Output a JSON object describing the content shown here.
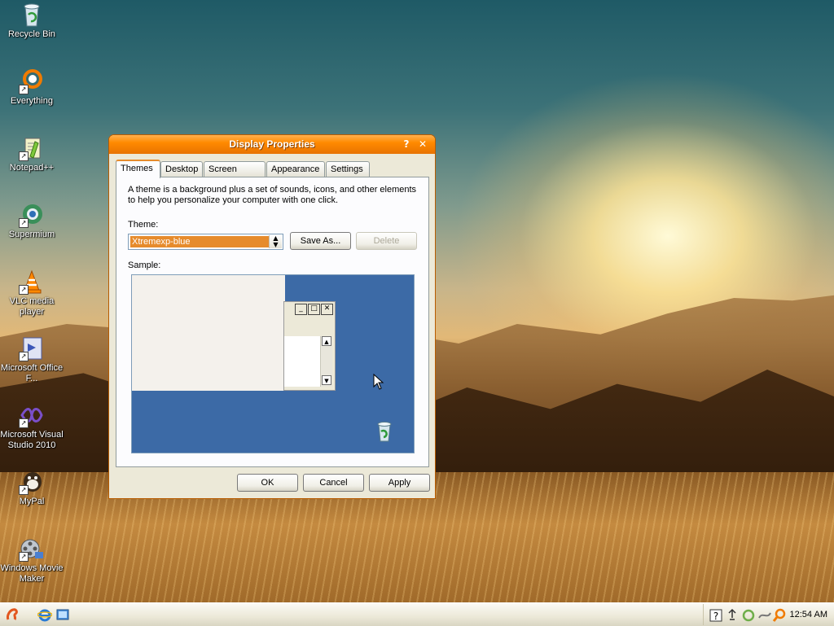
{
  "desktop": {
    "icons": [
      {
        "label": "Recycle Bin",
        "icon": "recycle-bin-icon"
      },
      {
        "label": "Everything",
        "icon": "everything-search-icon"
      },
      {
        "label": "Notepad++",
        "icon": "notepad-plus-plus-icon"
      },
      {
        "label": "Supermium",
        "icon": "supermium-browser-icon"
      },
      {
        "label": "VLC media player",
        "icon": "vlc-cone-icon"
      },
      {
        "label": "Microsoft Office F...",
        "icon": "office-frontpage-icon"
      },
      {
        "label": "Microsoft Visual Studio 2010",
        "icon": "visual-studio-icon"
      },
      {
        "label": "MyPal",
        "icon": "mypal-browser-icon"
      },
      {
        "label": "Windows Movie Maker",
        "icon": "movie-maker-icon"
      }
    ]
  },
  "window": {
    "title": "Display Properties",
    "help_glyph": "?",
    "close_glyph": "✕",
    "tabs": [
      {
        "label": "Themes",
        "active": true
      },
      {
        "label": "Desktop"
      },
      {
        "label": "Screen Saver"
      },
      {
        "label": "Appearance"
      },
      {
        "label": "Settings"
      }
    ],
    "description": "A theme is a background plus a set of sounds, icons, and other elements to help you personalize your computer with one click.",
    "theme_label": "Theme:",
    "theme_value": "Xtremexp-blue",
    "save_as_label": "Save As...",
    "delete_label": "Delete",
    "sample_label": "Sample:",
    "ok_label": "OK",
    "cancel_label": "Cancel",
    "apply_label": "Apply"
  },
  "taskbar": {
    "clock": "12:54 AM"
  },
  "colors": {
    "title_bar": "#ff8a00",
    "selection": "#e68b2c",
    "sample_desktop": "#3c6aa6",
    "window_face": "#ece9d8"
  }
}
